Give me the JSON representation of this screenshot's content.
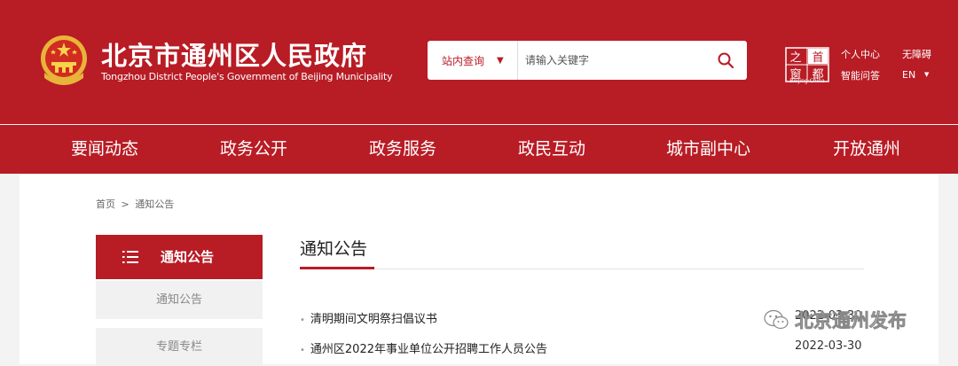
{
  "header": {
    "title": "北京市通州区人民政府",
    "subtitle": "Tongzhou District People's Government of Beijing Municipality",
    "emblem_icon": "national-emblem-icon",
    "search": {
      "scope_label": "站内查询",
      "placeholder": "请输入关键字"
    },
    "capital_logo": {
      "chars": [
        "之",
        "首",
        "窗",
        "都"
      ],
      "caption": "Beijing·China"
    },
    "links": {
      "personal_center": "个人中心",
      "accessibility": "无障碍",
      "smart_qa": "智能问答",
      "language": "EN"
    }
  },
  "nav": {
    "items": [
      "要闻动态",
      "政务公开",
      "政务服务",
      "政民互动",
      "城市副中心",
      "开放通州"
    ]
  },
  "breadcrumb": {
    "home": "首页",
    "separator": ">",
    "current": "通知公告"
  },
  "sidebar": {
    "title": "通知公告",
    "items": [
      "通知公告",
      "专题专栏"
    ]
  },
  "main": {
    "title": "通知公告",
    "news": [
      {
        "title": "清明期间文明祭扫倡议书",
        "date": "2022-03-30"
      },
      {
        "title": "通州区2022年事业单位公开招聘工作人员公告",
        "date": "2022-03-30"
      }
    ]
  },
  "watermark": {
    "text": "北京通州发布"
  },
  "colors": {
    "brand_red": "#b81c25",
    "content_bg": "#ffffff",
    "page_bg": "#f3f3f3"
  }
}
